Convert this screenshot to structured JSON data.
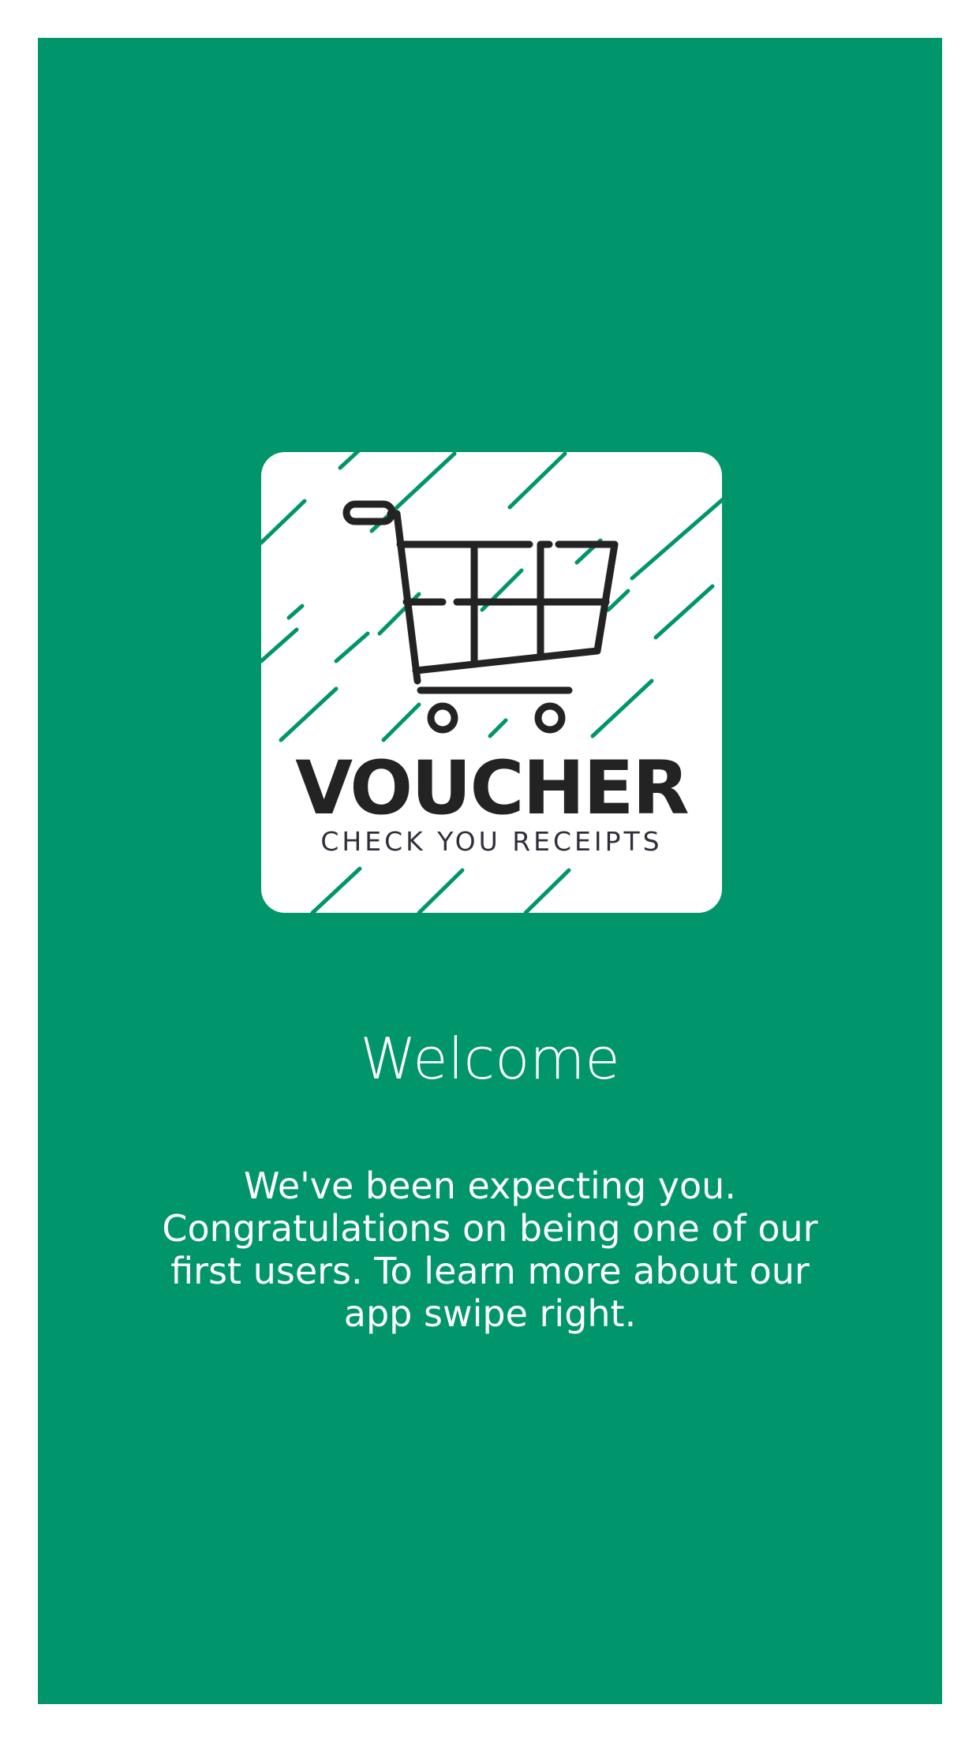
{
  "colors": {
    "background": "#00956a",
    "accent_stripes": "#00956a",
    "logo_dark": "#232323",
    "card": "#ffffff",
    "text": "#ffffff"
  },
  "logo": {
    "icon": "shopping-cart-icon",
    "brand_name": "VOUCHER",
    "tagline": "CHECK YOU RECEIPTS"
  },
  "welcome": {
    "title": "Welcome",
    "message": "We've been expecting you. Congratulations on being one of our first users. To learn more about our app swipe right."
  }
}
